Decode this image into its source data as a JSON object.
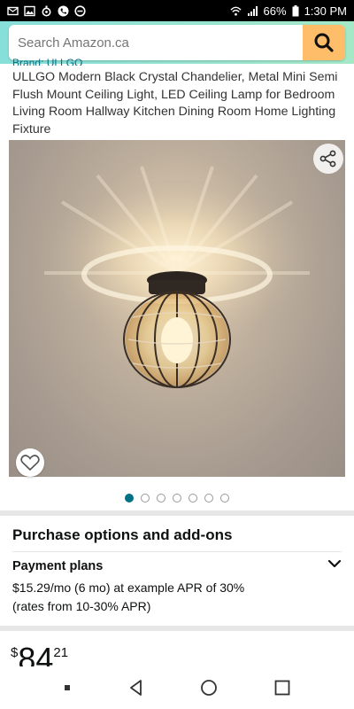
{
  "status_bar": {
    "battery": "66%",
    "time": "1:30 PM"
  },
  "search": {
    "placeholder": "Search Amazon.ca"
  },
  "product": {
    "brand_partial": "Brand: ULLGO",
    "title": "ULLGO Modern Black Crystal Chandelier, Metal Mini Semi Flush Mount Ceiling Light, LED Ceiling Lamp for Bedroom Living Room Hallway Kitchen Dining Room Home Lighting Fixture",
    "image_count": 7,
    "active_image_index": 0
  },
  "purchase": {
    "section_title": "Purchase options and add-ons",
    "payment_title": "Payment plans",
    "payment_line1": "$15.29/mo (6 mo) at example APR of 30%",
    "payment_line2": "(rates from 10-30% APR)"
  },
  "price": {
    "symbol": "$",
    "whole": "84",
    "fraction": "21"
  },
  "colors": {
    "search_button": "#febd69",
    "accent_dot": "#007185",
    "header_gradient_start": "#87dfd9"
  },
  "icons": {
    "search": "search-icon",
    "share": "share-icon",
    "wishlist": "heart-icon",
    "chevron": "chevron-down-icon"
  }
}
